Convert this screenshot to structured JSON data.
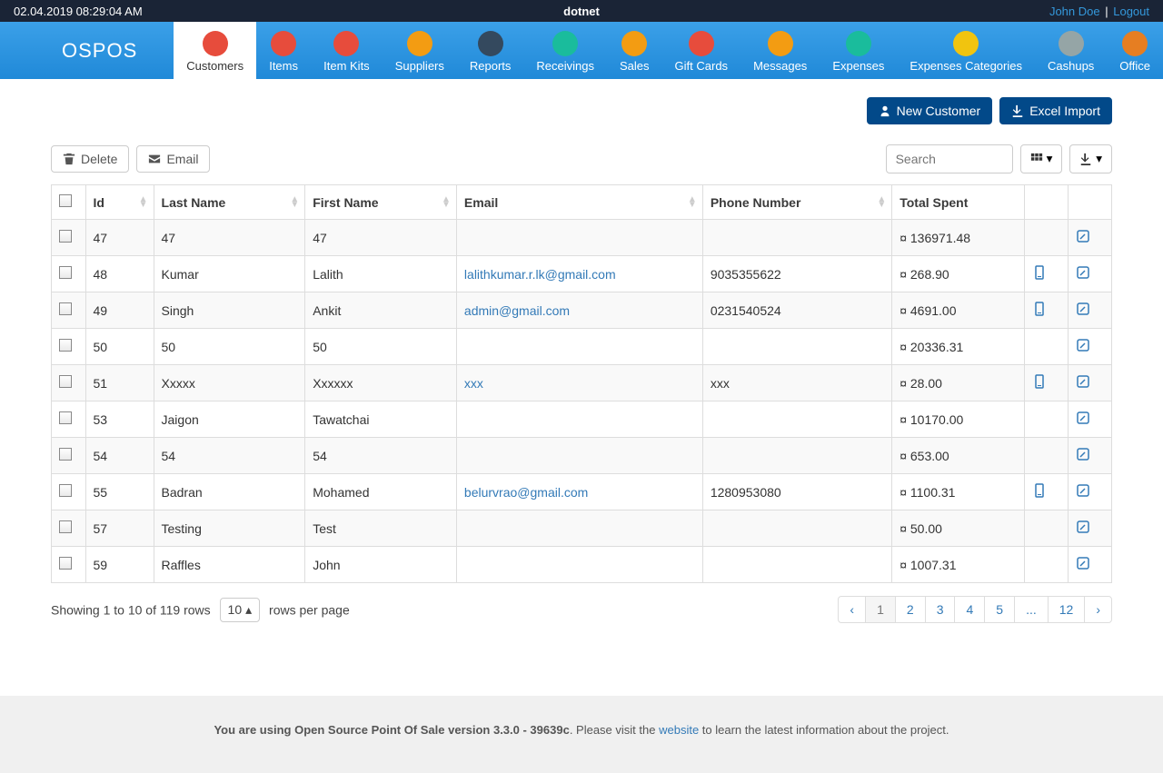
{
  "topbar": {
    "datetime": "02.04.2019 08:29:04 AM",
    "center": "dotnet",
    "user": "John Doe",
    "logout": "Logout"
  },
  "brand": "OSPOS",
  "nav": [
    {
      "label": "Customers",
      "icon": "#e74c3c",
      "active": true
    },
    {
      "label": "Items",
      "icon": "#e74c3c"
    },
    {
      "label": "Item Kits",
      "icon": "#e74c3c"
    },
    {
      "label": "Suppliers",
      "icon": "#f39c12"
    },
    {
      "label": "Reports",
      "icon": "#34495e"
    },
    {
      "label": "Receivings",
      "icon": "#1abc9c"
    },
    {
      "label": "Sales",
      "icon": "#f39c12"
    },
    {
      "label": "Gift Cards",
      "icon": "#e74c3c"
    },
    {
      "label": "Messages",
      "icon": "#f39c12"
    },
    {
      "label": "Expenses",
      "icon": "#1abc9c"
    },
    {
      "label": "Expenses Categories",
      "icon": "#f1c40f"
    },
    {
      "label": "Cashups",
      "icon": "#95a5a6"
    },
    {
      "label": "Office",
      "icon": "#e67e22"
    }
  ],
  "actions": {
    "new_customer": "New Customer",
    "excel_import": "Excel Import"
  },
  "toolbar": {
    "delete": "Delete",
    "email": "Email",
    "search_placeholder": "Search"
  },
  "table": {
    "headers": {
      "id": "Id",
      "last_name": "Last Name",
      "first_name": "First Name",
      "email": "Email",
      "phone": "Phone Number",
      "total_spent": "Total Spent"
    },
    "rows": [
      {
        "id": "47",
        "last": "47",
        "first": "47",
        "email": "",
        "phone": "",
        "spent": "¤ 136971.48",
        "sms": false
      },
      {
        "id": "48",
        "last": "Kumar",
        "first": "Lalith",
        "email": "lalithkumar.r.lk@gmail.com",
        "phone": "9035355622",
        "spent": "¤ 268.90",
        "sms": true
      },
      {
        "id": "49",
        "last": "Singh",
        "first": "Ankit",
        "email": "admin@gmail.com",
        "phone": "0231540524",
        "spent": "¤ 4691.00",
        "sms": true
      },
      {
        "id": "50",
        "last": "50",
        "first": "50",
        "email": "",
        "phone": "",
        "spent": "¤ 20336.31",
        "sms": false
      },
      {
        "id": "51",
        "last": "Xxxxx",
        "first": "Xxxxxx",
        "email": "xxx",
        "phone": "xxx",
        "spent": "¤ 28.00",
        "sms": true
      },
      {
        "id": "53",
        "last": "Jaigon",
        "first": "Tawatchai",
        "email": "",
        "phone": "",
        "spent": "¤ 10170.00",
        "sms": false
      },
      {
        "id": "54",
        "last": "54",
        "first": "54",
        "email": "",
        "phone": "",
        "spent": "¤ 653.00",
        "sms": false
      },
      {
        "id": "55",
        "last": "Badran",
        "first": "Mohamed",
        "email": "belurvrao@gmail.com",
        "phone": "1280953080",
        "spent": "¤ 1100.31",
        "sms": true
      },
      {
        "id": "57",
        "last": "Testing",
        "first": "Test",
        "email": "",
        "phone": "",
        "spent": "¤ 50.00",
        "sms": false
      },
      {
        "id": "59",
        "last": "Raffles",
        "first": "John",
        "email": "",
        "phone": "",
        "spent": "¤ 1007.31",
        "sms": false
      }
    ]
  },
  "footer": {
    "showing": "Showing 1 to 10 of 119 rows",
    "page_size": "10",
    "rows_per_page": "rows per page",
    "pages": [
      "‹",
      "1",
      "2",
      "3",
      "4",
      "5",
      "...",
      "12",
      "›"
    ],
    "active_page": "1"
  },
  "site_footer": {
    "bold": "You are using Open Source Point Of Sale version 3.3.0 - 39639c",
    "text1": ". Please visit the ",
    "link": "website",
    "text2": " to learn the latest information about the project."
  }
}
